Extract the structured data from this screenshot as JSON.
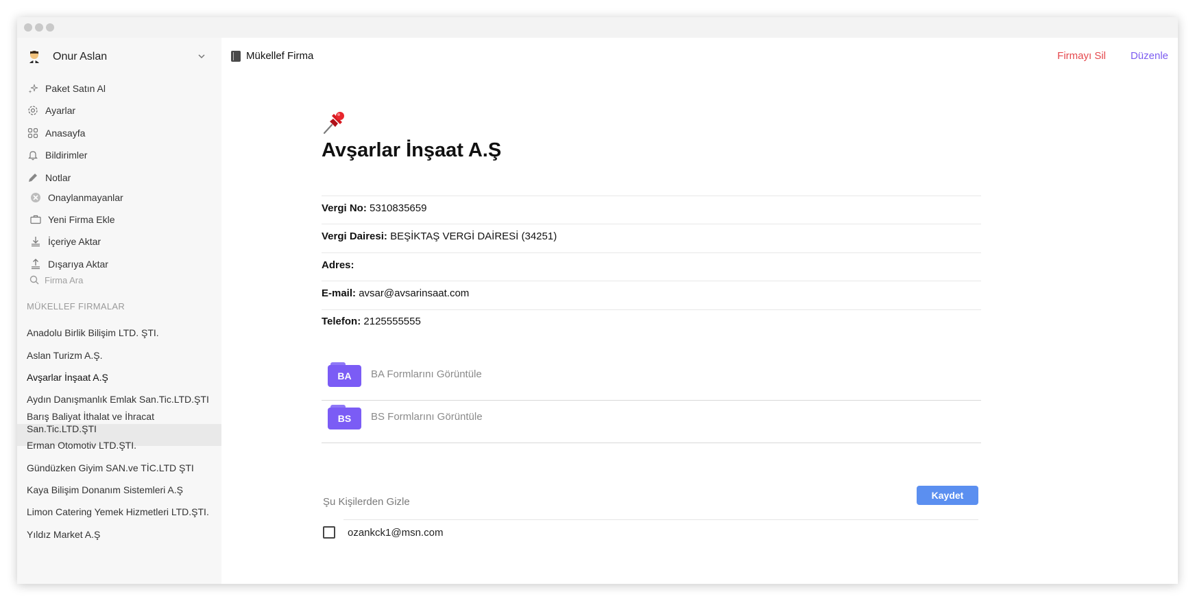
{
  "user": {
    "name": "Onur Aslan",
    "avatar_icon": "man-emoji-icon"
  },
  "nav": [
    {
      "label": "Paket Satın Al",
      "icon": "sparkles-icon"
    },
    {
      "label": "Ayarlar",
      "icon": "gear-icon"
    },
    {
      "label": "Anasayfa",
      "icon": "grid-icon"
    },
    {
      "label": "Bildirimler",
      "icon": "bell-icon"
    },
    {
      "label": "Notlar",
      "icon": "pencil-icon"
    },
    {
      "label": "Onaylanmayanlar",
      "icon": "x-circle-icon"
    },
    {
      "label": "Yeni Firma Ekle",
      "icon": "briefcase-icon"
    },
    {
      "label": "İçeriye Aktar",
      "icon": "download-icon"
    },
    {
      "label": "Dışarıya Aktar",
      "icon": "upload-icon"
    }
  ],
  "search": {
    "placeholder": "Firma Ara"
  },
  "section_label": "MÜKELLEF FIRMALAR",
  "firms": [
    "Anadolu Birlik Bilişim LTD. ŞTI.",
    "Aslan Turizm A.Ş.",
    "Avşarlar İnşaat A.Ş",
    "Aydın Danışmanlık Emlak San.Tic.LTD.ŞTI",
    "Barış Baliyat İthalat ve İhracat San.Tic.LTD.ŞTI",
    "Erman Otomotiv LTD.ŞTI.",
    "Gündüzken Giyim SAN.ve TİC.LTD ŞTI",
    "Kaya Bilişim Donanım Sistemleri A.Ş",
    "Limon Catering Yemek Hizmetleri LTD.ŞTI.",
    "Yıldız Market A.Ş"
  ],
  "active_firm": "Avşarlar İnşaat A.Ş",
  "header": {
    "title": "Mükellef Firma",
    "delete_label": "Firmayı Sil",
    "edit_label": "Düzenle"
  },
  "company": {
    "name": "Avşarlar İnşaat A.Ş",
    "fields": [
      {
        "label": "Vergi No:",
        "value": "5310835659"
      },
      {
        "label": "Vergi Dairesi:",
        "value": "BEŞİKTAŞ VERGİ DAİRESİ (34251)"
      },
      {
        "label": "Adres:",
        "value": ""
      },
      {
        "label": "E-mail:",
        "value": "avsar@avsarinsaat.com"
      },
      {
        "label": "Telefon:",
        "value": "2125555555"
      }
    ]
  },
  "forms": [
    {
      "badge": "BA",
      "label": "BA Formlarını Görüntüle"
    },
    {
      "badge": "BS",
      "label": "BS Formlarını Görüntüle"
    }
  ],
  "hide": {
    "label": "Şu Kişilerden Gizle",
    "save_label": "Kaydet",
    "people": [
      {
        "email": "ozankck1@msn.com",
        "checked": false
      }
    ]
  },
  "colors": {
    "accent": "#7b5cf5",
    "danger": "#e5484d",
    "edit": "#7c5cf0",
    "save": "#5b8ff0"
  }
}
